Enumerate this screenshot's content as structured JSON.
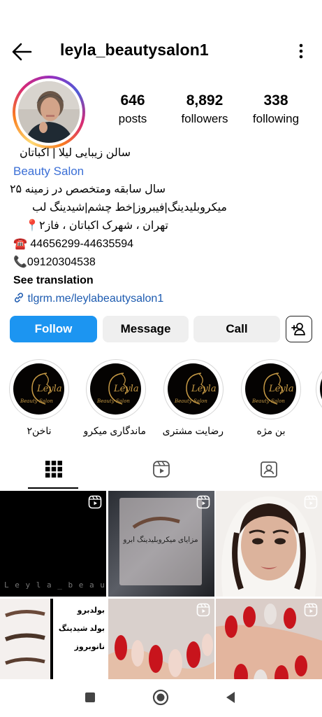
{
  "header": {
    "username": "leyla_beautysalon1",
    "back_icon": "arrow-left-icon",
    "more_icon": "more-vertical-icon"
  },
  "stats": {
    "posts_count": "646",
    "posts_label": "posts",
    "followers_count": "8,892",
    "followers_label": "followers",
    "following_count": "338",
    "following_label": "following"
  },
  "bio": {
    "name": "سالن زیبایی لیلا | اکباتان",
    "category": "Beauty Salon",
    "line1": "سال سابقه ومتخصص در زمینه ۲۵",
    "line2": "میکروبلیدینگ|فیبروز|خط چشم|شیدینگ لب",
    "line3": "تهران ، شهرک اکباتان ، فاز۲📍",
    "line4": "☎️ 44656299-44635594",
    "line5": "📞09120304538",
    "see_translation": "See translation",
    "link": "tlgrm.me/leylabeautysalon1"
  },
  "buttons": {
    "follow": "Follow",
    "message": "Message",
    "call": "Call"
  },
  "highlights": [
    {
      "label": "بن مژه",
      "logo_text": "Leyla",
      "sub_text": "Beauty Salon"
    },
    {
      "label": "رضایت مشتری",
      "logo_text": "Leyla",
      "sub_text": "Beauty Salon"
    },
    {
      "label": "ماندگاری میکرو",
      "logo_text": "Leyla",
      "sub_text": "Beauty Salon"
    },
    {
      "label": "ناخن۲",
      "logo_text": "Leyla",
      "sub_text": "Beauty Salon"
    }
  ],
  "tabs": [
    "grid-icon",
    "reels-icon",
    "tagged-icon"
  ],
  "posts": {
    "p1_caption": "L e y l a _ b e a u t y",
    "p2_caption": "مزایای میکروبلیدینگ ابرو",
    "p4_lines": [
      "بولدبرو",
      "بولد شیدینگ",
      "نانوبروز"
    ]
  },
  "colors": {
    "follow_blue": "#1c95f1",
    "link_blue": "#1d5bb0",
    "gold": "#c79a45"
  }
}
